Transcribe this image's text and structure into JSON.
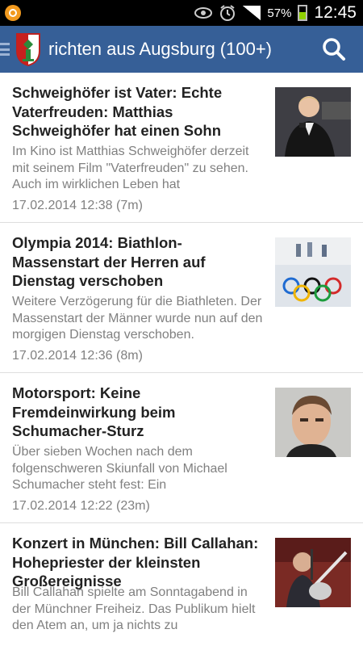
{
  "statusbar": {
    "battery_percent": "57%",
    "time": "12:45"
  },
  "appbar": {
    "title": "richten aus Augsburg (100+)"
  },
  "articles": [
    {
      "headline": "Schweighöfer ist Vater: Echte Vaterfreuden: Matthias Schweighöfer hat einen Sohn",
      "teaser": "Im Kino ist Matthias Schweighöfer derzeit mit seinem Film \"Vaterfreuden\" zu sehen. Auch im wirklichen Leben hat",
      "date": "17.02.2014 12:38 (7m)"
    },
    {
      "headline": "Olympia 2014: Biathlon-Massenstart der Herren auf Dienstag verschoben",
      "teaser": "Weitere Verzögerung für die Biathleten. Der Massenstart der Männer wurde nun auf den morgigen Dienstag verschoben.",
      "date": "17.02.2014 12:36 (8m)"
    },
    {
      "headline": "Motorsport: Keine Fremdeinwirkung beim Schumacher-Sturz",
      "teaser": "Über sieben Wochen nach dem folgenschweren Skiunfall von Michael Schumacher steht fest: Ein",
      "date": "17.02.2014 12:22 (23m)"
    },
    {
      "headline": "Konzert in München: Bill Callahan: Hohepriester der kleinsten Großereignisse",
      "teaser": "Bill Callahan spielte am Sonntagabend in der Münchner Freiheiz. Das Publikum hielt den Atem an, um ja nichts zu",
      "date": ""
    }
  ]
}
